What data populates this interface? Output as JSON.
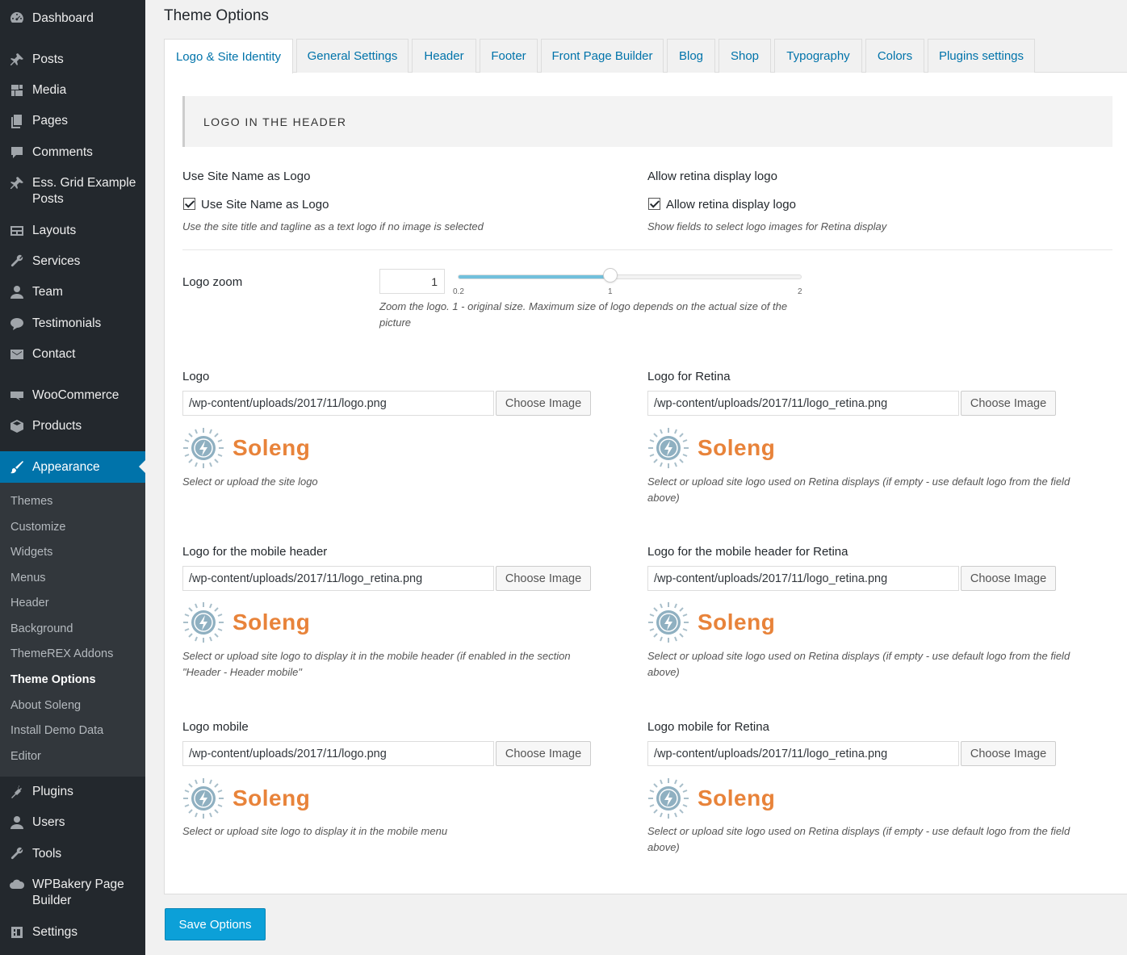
{
  "sidebar": {
    "items": [
      {
        "label": "Dashboard",
        "icon": "dashboard-icon"
      },
      {
        "label": "Posts",
        "icon": "pin-icon"
      },
      {
        "label": "Media",
        "icon": "media-icon"
      },
      {
        "label": "Pages",
        "icon": "pages-icon"
      },
      {
        "label": "Comments",
        "icon": "comment-icon"
      },
      {
        "label": "Ess. Grid Example Posts",
        "icon": "pin-icon"
      },
      {
        "label": "Layouts",
        "icon": "layouts-icon"
      },
      {
        "label": "Services",
        "icon": "wrench-icon"
      },
      {
        "label": "Team",
        "icon": "user-icon"
      },
      {
        "label": "Testimonials",
        "icon": "chat-icon"
      },
      {
        "label": "Contact",
        "icon": "mail-icon"
      },
      {
        "label": "WooCommerce",
        "icon": "woo-icon"
      },
      {
        "label": "Products",
        "icon": "box-icon"
      },
      {
        "label": "Appearance",
        "icon": "brush-icon"
      },
      {
        "label": "Plugins",
        "icon": "plug-icon"
      },
      {
        "label": "Users",
        "icon": "user-icon"
      },
      {
        "label": "Tools",
        "icon": "wrench-icon"
      },
      {
        "label": "WPBakery Page Builder",
        "icon": "cloud-icon"
      },
      {
        "label": "Settings",
        "icon": "settings-icon"
      }
    ],
    "submenu": [
      "Themes",
      "Customize",
      "Widgets",
      "Menus",
      "Header",
      "Background",
      "ThemeREX Addons",
      "Theme Options",
      "About Soleng",
      "Install Demo Data",
      "Editor"
    ]
  },
  "page": {
    "title": "Theme Options"
  },
  "tabs": [
    "Logo & Site Identity",
    "General Settings",
    "Header",
    "Footer",
    "Front Page Builder",
    "Blog",
    "Shop",
    "Typography",
    "Colors",
    "Plugins settings"
  ],
  "section": {
    "title": "LOGO IN THE HEADER"
  },
  "site_name": {
    "title": "Use Site Name as Logo",
    "checkbox_label": "Use Site Name as Logo",
    "checked": true,
    "desc": "Use the site title and tagline as a text logo if no image is selected"
  },
  "retina": {
    "title": "Allow retina display logo",
    "checkbox_label": "Allow retina display logo",
    "checked": true,
    "desc": "Show fields to select logo images for Retina display"
  },
  "zoom": {
    "title": "Logo zoom",
    "value": "1",
    "min": 0.2,
    "max": 2,
    "tick_min": "0.2",
    "tick_mid": "1",
    "tick_max": "2",
    "desc": "Zoom the logo. 1 - original size. Maximum size of logo depends on the actual size of the picture"
  },
  "logo_fields": [
    {
      "title": "Logo",
      "value": "/wp-content/uploads/2017/11/logo.png",
      "button": "Choose Image",
      "brand": "Soleng",
      "desc": "Select or upload the site logo"
    },
    {
      "title": "Logo for Retina",
      "value": "/wp-content/uploads/2017/11/logo_retina.png",
      "button": "Choose Image",
      "brand": "Soleng",
      "desc": "Select or upload site logo used on Retina displays (if empty - use default logo from the field above)"
    },
    {
      "title": "Logo for the mobile header",
      "value": "/wp-content/uploads/2017/11/logo_retina.png",
      "button": "Choose Image",
      "brand": "Soleng",
      "desc": "Select or upload site logo to display it in the mobile header (if enabled in the section \"Header - Header mobile\""
    },
    {
      "title": "Logo for the mobile header for Retina",
      "value": "/wp-content/uploads/2017/11/logo_retina.png",
      "button": "Choose Image",
      "brand": "Soleng",
      "desc": "Select or upload site logo used on Retina displays (if empty - use default logo from the field above)"
    },
    {
      "title": "Logo mobile",
      "value": "/wp-content/uploads/2017/11/logo.png",
      "button": "Choose Image",
      "brand": "Soleng",
      "desc": "Select or upload site logo to display it in the mobile menu"
    },
    {
      "title": "Logo mobile for Retina",
      "value": "/wp-content/uploads/2017/11/logo_retina.png",
      "button": "Choose Image",
      "brand": "Soleng",
      "desc": "Select or upload site logo used on Retina displays (if empty - use default logo from the field above)"
    }
  ],
  "save_label": "Save Options",
  "colors": {
    "accent": "#0073aa",
    "brand_orange": "#e8833a",
    "save_button": "#0ca0d8"
  }
}
